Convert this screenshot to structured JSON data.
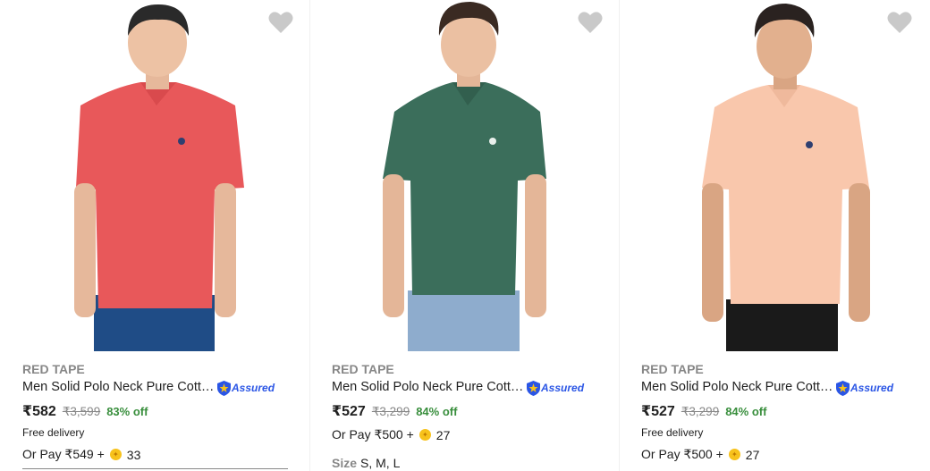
{
  "products": [
    {
      "brand": "RED TAPE",
      "title": "Men Solid Polo Neck Pure Cotto...",
      "assured_label": "Assured",
      "price": "₹582",
      "mrp": "₹3,599",
      "discount": "83% off",
      "delivery": "Free delivery",
      "or_pay": "Or Pay ₹549 +",
      "coins": "33",
      "shirt_color": "#e8585a",
      "pants_color": "#1f4c86",
      "wishlist_icon": "heart-icon"
    },
    {
      "brand": "RED TAPE",
      "title": "Men Solid Polo Neck Pure Cotto...",
      "assured_label": "Assured",
      "price": "₹527",
      "mrp": "₹3,299",
      "discount": "84% off",
      "or_pay": "Or Pay ₹500 +",
      "coins": "27",
      "size_label": "Size",
      "sizes": "S, M, L",
      "shirt_color": "#3b6e5b",
      "pants_color": "#8eaccd",
      "wishlist_icon": "heart-icon"
    },
    {
      "brand": "RED TAPE",
      "title": "Men Solid Polo Neck Pure Cotto...",
      "assured_label": "Assured",
      "price": "₹527",
      "mrp": "₹3,299",
      "discount": "84% off",
      "delivery": "Free delivery",
      "or_pay": "Or Pay ₹500 +",
      "coins": "27",
      "shirt_color": "#f9c7ac",
      "pants_color": "#1a1a1a",
      "wishlist_icon": "heart-icon"
    }
  ],
  "colors": {
    "discount_green": "#388e3c",
    "assured_blue": "#2a55e5",
    "muted_gray": "#878787"
  }
}
